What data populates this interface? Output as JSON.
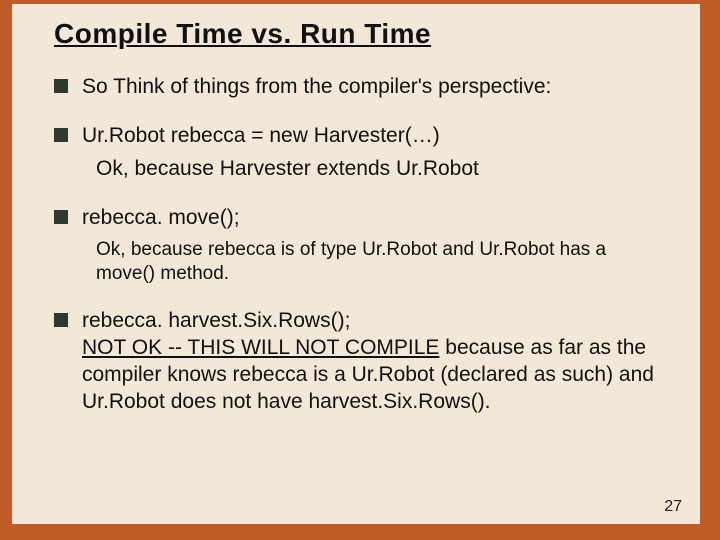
{
  "title": "Compile Time vs. Run Time",
  "bullets": {
    "b1": "So Think of things from the compiler's perspective:",
    "b2": "Ur.Robot rebecca = new Harvester(…)",
    "b2_sub": "Ok, because Harvester extends Ur.Robot",
    "b3": "rebecca. move();",
    "b3_sub": "Ok, because rebecca is of type Ur.Robot and Ur.Robot has a move() method.",
    "b4_line1": "rebecca. harvest.Six.Rows();",
    "b4_underline": " NOT OK -- THIS WILL NOT COMPILE",
    "b4_rest": " because as far as the compiler knows rebecca is a Ur.Robot (declared as such) and Ur.Robot does not have harvest.Six.Rows()."
  },
  "page_number": "27"
}
